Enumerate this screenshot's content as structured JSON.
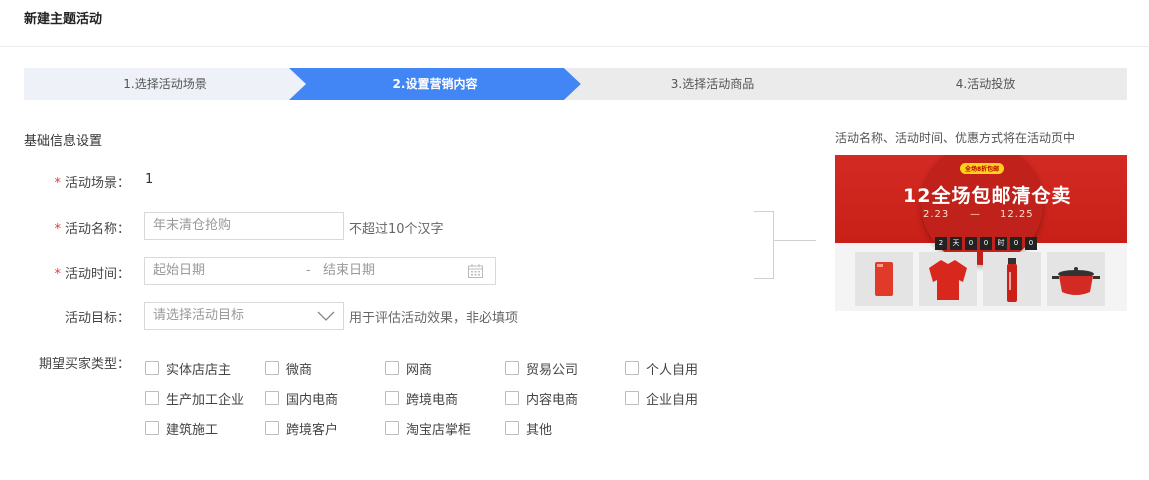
{
  "page": {
    "title": "新建主题活动"
  },
  "steps": [
    {
      "label": "1.选择活动场景",
      "active": false
    },
    {
      "label": "2.设置营销内容",
      "active": true
    },
    {
      "label": "3.选择活动商品",
      "active": false
    },
    {
      "label": "4.活动投放",
      "active": false
    }
  ],
  "colors": {
    "step_active": "#4285f4",
    "step_first": "#eef1f8",
    "step_inactive": "#ebebeb",
    "required": "#e53935"
  },
  "section": {
    "title": "基础信息设置"
  },
  "form": {
    "required_mark": "*",
    "scene": {
      "label": "活动场景：",
      "value": "1"
    },
    "name": {
      "label": "活动名称：",
      "placeholder": "年末清仓抢购",
      "hint": "不超过10个汉字"
    },
    "time": {
      "label": "活动时间：",
      "start_placeholder": "起始日期",
      "separator": "-",
      "end_placeholder": "结束日期",
      "icon": "calendar-icon"
    },
    "goal": {
      "label": "活动目标：",
      "placeholder": "请选择活动目标",
      "hint": "用于评估活动效果，非必填项",
      "icon": "chevron-down-icon"
    },
    "buyer_types": {
      "label": "期望买家类型：",
      "options": [
        "实体店店主",
        "微商",
        "网商",
        "贸易公司",
        "个人自用",
        "生产加工企业",
        "国内电商",
        "跨境电商",
        "内容电商",
        "企业自用",
        "建筑施工",
        "跨境客户",
        "淘宝店掌柜",
        "其他"
      ]
    }
  },
  "preview": {
    "note": "活动名称、活动时间、优惠方式将在活动页中",
    "banner": {
      "tag": "全场8折包邮",
      "headline": "12全场包邮清仓卖",
      "date_left": "2.23",
      "dash": "—",
      "date_right": "12.25",
      "countdown": [
        "2",
        "天",
        "0",
        "0",
        "时",
        "0",
        "0"
      ]
    },
    "products": [
      "power-bank",
      "red-jacket",
      "red-bottle",
      "red-pot"
    ]
  }
}
